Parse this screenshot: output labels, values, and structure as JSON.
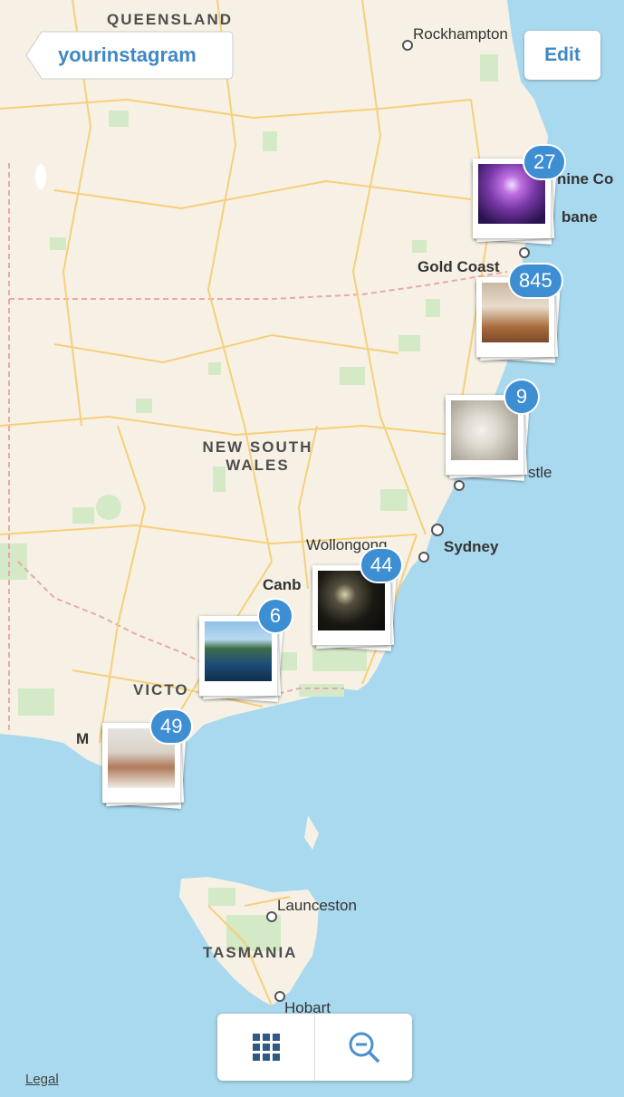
{
  "nav": {
    "back_label": "yourinstagram",
    "edit_label": "Edit"
  },
  "map": {
    "regions": {
      "queensland": "QUEENSLAND",
      "nsw_line1": "NEW SOUTH",
      "nsw_line2": "WALES",
      "victoria": "VICTO",
      "tasmania": "TASMANIA"
    },
    "cities": {
      "rockhampton": "Rockhampton",
      "sunshine": "hine Co",
      "brisbane": "bane",
      "gold_coast": "Gold Coast",
      "newcastle": "stle",
      "wollongong": "Wollongong",
      "sydney": "Sydney",
      "canberra": "Canb",
      "melbourne": "M",
      "launceston": "Launceston",
      "hobart": "Hobart"
    },
    "colors": {
      "water": "#a9d9ee",
      "land": "#f6f1e4",
      "park": "#d4e9c6",
      "road": "#f6cf7a",
      "accent": "#3d8ed3"
    }
  },
  "clusters": [
    {
      "count": "27",
      "photo": "concert-photo"
    },
    {
      "count": "845",
      "photo": "dinner-photo"
    },
    {
      "count": "9",
      "photo": "towel-swan-photo"
    },
    {
      "count": "44",
      "photo": "night-lights-photo"
    },
    {
      "count": "6",
      "photo": "lake-photo"
    },
    {
      "count": "49",
      "photo": "bath-kids-photo"
    }
  ],
  "toolbar": {
    "grid_icon": "grid-icon",
    "zoom_out_icon": "zoom-out-icon"
  },
  "footer": {
    "legal_label": "Legal"
  }
}
